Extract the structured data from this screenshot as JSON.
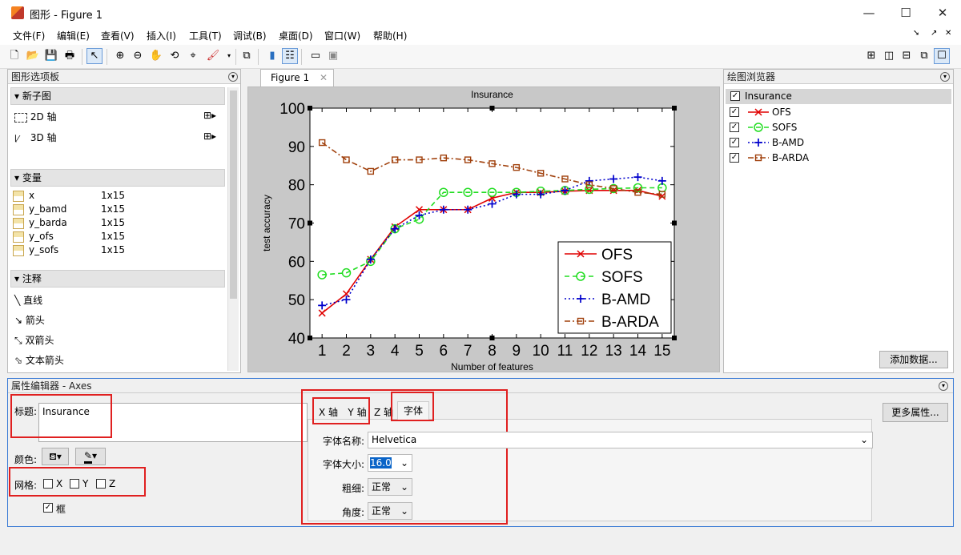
{
  "window": {
    "title": "图形 - Figure 1",
    "min": "—",
    "max": "☐",
    "close": "✕"
  },
  "menu": [
    "文件(F)",
    "编辑(E)",
    "查看(V)",
    "插入(I)",
    "工具(T)",
    "调试(B)",
    "桌面(D)",
    "窗口(W)",
    "帮助(H)"
  ],
  "palette": {
    "title": "图形选项板",
    "sections": {
      "subplot": "新子图",
      "vars": "变量",
      "annot": "注释"
    },
    "subplot_items": [
      "2D 轴",
      "3D 轴"
    ],
    "variables": [
      {
        "name": "x",
        "size": "1x15"
      },
      {
        "name": "y_bamd",
        "size": "1x15"
      },
      {
        "name": "y_barda",
        "size": "1x15"
      },
      {
        "name": "y_ofs",
        "size": "1x15"
      },
      {
        "name": "y_sofs",
        "size": "1x15"
      }
    ],
    "annotations": [
      "直线",
      "箭头",
      "双箭头",
      "文本箭头"
    ]
  },
  "figure_tab": "Figure 1",
  "browser": {
    "title": "绘图浏览器",
    "axes": "Insurance",
    "series": [
      "OFS",
      "SOFS",
      "B-AMD",
      "B-ARDA"
    ],
    "add_data": "添加数据..."
  },
  "property_editor": {
    "title": "属性编辑器 - Axes",
    "title_label": "标题:",
    "title_value": "Insurance",
    "color_label": "颜色:",
    "grid_label": "网格:",
    "grid_x": "X",
    "grid_y": "Y",
    "grid_z": "Z",
    "box_label": "框",
    "tabs": [
      "X 轴",
      "Y 轴",
      "Z 轴",
      "字体"
    ],
    "font_name_label": "字体名称:",
    "font_name": "Helvetica",
    "font_size_label": "字体大小:",
    "font_size": "16.0",
    "weight_label": "粗细:",
    "weight": "正常",
    "angle_label": "角度:",
    "angle": "正常",
    "more": "更多属性..."
  },
  "chart_data": {
    "type": "line",
    "title": "Insurance",
    "xlabel": "Number of features",
    "ylabel": "test accuracy",
    "x": [
      1,
      2,
      3,
      4,
      5,
      6,
      7,
      8,
      9,
      10,
      11,
      12,
      13,
      14,
      15
    ],
    "ylim": [
      40,
      100
    ],
    "yticks": [
      40,
      50,
      60,
      70,
      80,
      90,
      100
    ],
    "legend": "bottom-right",
    "series": [
      {
        "name": "OFS",
        "color": "#e00000",
        "marker": "x",
        "dash": "",
        "values": [
          46.5,
          51.5,
          60.5,
          69,
          73.5,
          73.5,
          73.5,
          76.5,
          78,
          78,
          78.3,
          78.5,
          78.5,
          78.5,
          77
        ]
      },
      {
        "name": "SOFS",
        "color": "#22dd22",
        "marker": "o",
        "dash": "6,4",
        "values": [
          56.5,
          57,
          60,
          68.5,
          71,
          78,
          78,
          78,
          78,
          78.3,
          78.5,
          78.8,
          79,
          79.2,
          79.2
        ]
      },
      {
        "name": "B-AMD",
        "color": "#0000cc",
        "marker": "+",
        "dash": "2,3",
        "values": [
          48.5,
          50,
          60.5,
          68.5,
          72,
          73.5,
          73.5,
          75,
          77.5,
          77.5,
          78.5,
          81,
          81.5,
          82,
          81
        ]
      },
      {
        "name": "B-ARDA",
        "color": "#a0400c",
        "marker": "s",
        "dash": "7,3,2,3",
        "values": [
          91,
          86.5,
          83.5,
          86.5,
          86.5,
          87,
          86.5,
          85.5,
          84.5,
          83,
          81.5,
          80,
          79,
          78,
          77.5
        ]
      }
    ]
  }
}
